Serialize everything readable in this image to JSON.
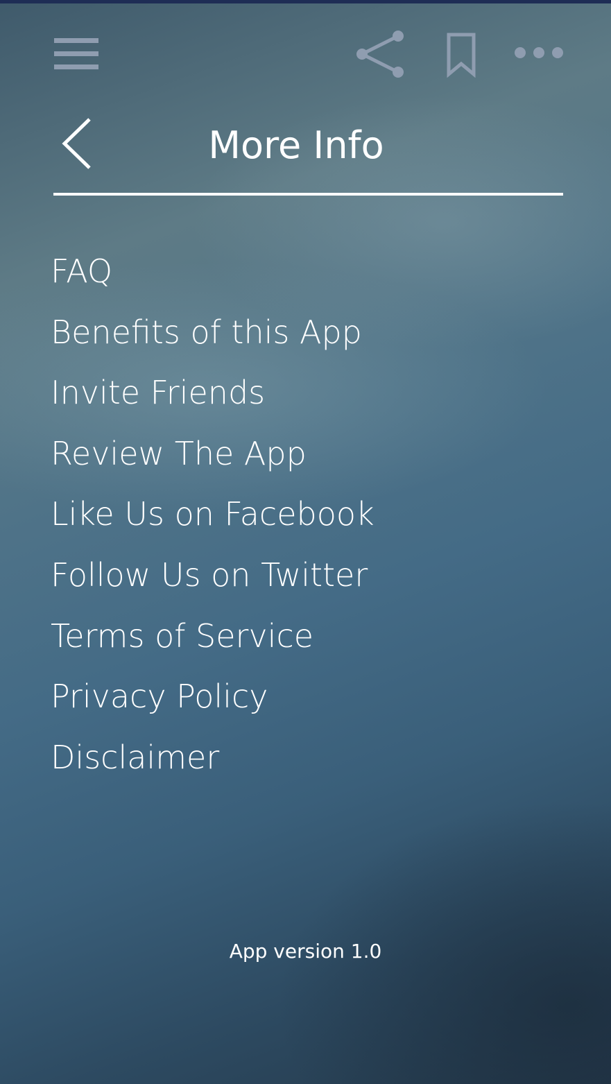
{
  "toolbar": {
    "menu_icon": "hamburger-menu-icon",
    "share_icon": "share-icon",
    "bookmark_icon": "bookmark-icon",
    "more_icon": "more-horizontal-icon",
    "icon_color": "#8f9db0"
  },
  "header": {
    "back_icon": "chevron-left-icon",
    "title": "More Info"
  },
  "menu": {
    "items": [
      {
        "label": "FAQ"
      },
      {
        "label": "Benefits of this App"
      },
      {
        "label": "Invite Friends"
      },
      {
        "label": "Review The App"
      },
      {
        "label": "Like Us on Facebook"
      },
      {
        "label": "Follow Us on Twitter"
      },
      {
        "label": "Terms of Service"
      },
      {
        "label": "Privacy Policy"
      },
      {
        "label": "Disclaimer"
      }
    ]
  },
  "footer": {
    "version": "App version 1.0"
  },
  "colors": {
    "text": "#ffffff",
    "background_top": "#3f5a6b",
    "background_bottom": "#24394b"
  }
}
